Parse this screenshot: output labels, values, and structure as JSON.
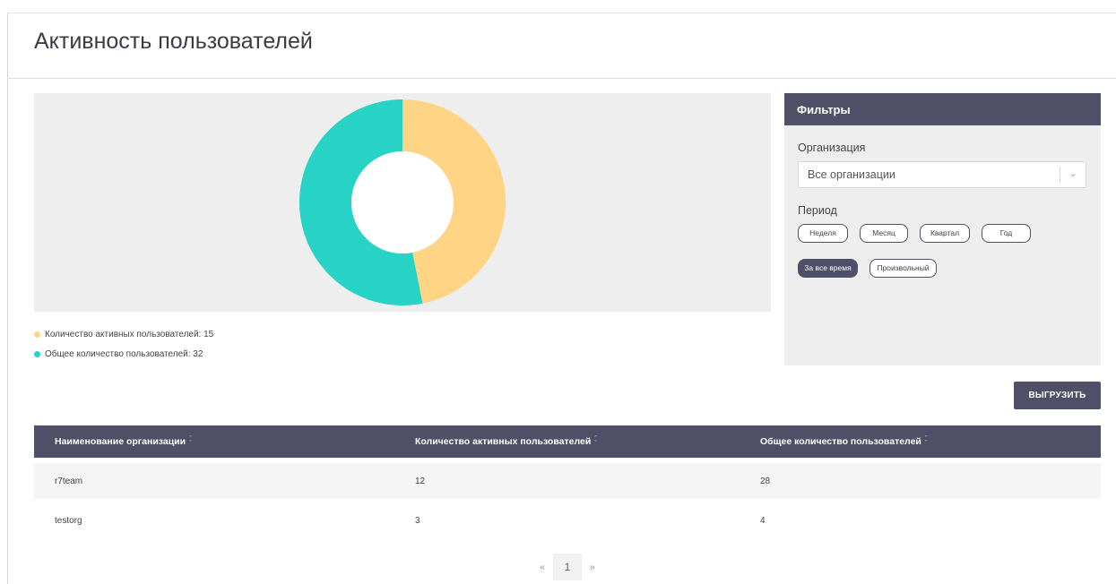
{
  "page": {
    "title": "Активность пользователей"
  },
  "chart_data": {
    "type": "pie",
    "donut": true,
    "slices": [
      {
        "label": "Количество активных пользователей",
        "value": 15,
        "color": "#ffd485"
      },
      {
        "label": "Общее количество пользователей",
        "value": 32,
        "color": "#26d3c4"
      }
    ]
  },
  "legend": {
    "items": [
      {
        "text": "Количество активных пользователей: 15",
        "color": "#ffd485"
      },
      {
        "text": "Общее количество пользователей: 32",
        "color": "#26d3c4"
      }
    ]
  },
  "filters": {
    "title": "Фильтры",
    "organization_label": "Организация",
    "organization_value": "Все организации",
    "period_label": "Период",
    "period_options": [
      "Неделя",
      "Месяц",
      "Квартал",
      "Год",
      "За все время",
      "Произвольный"
    ],
    "period_selected": "За все время"
  },
  "export_label": "ВЫГРУЗИТЬ",
  "table": {
    "headers": [
      "Наименование организации",
      "Количество активных пользователей",
      "Общее количество пользователей"
    ],
    "rows": [
      [
        "r7team",
        "12",
        "28"
      ],
      [
        "testorg",
        "3",
        "4"
      ]
    ]
  },
  "pagination": {
    "prev": "«",
    "current": "1",
    "next": "»"
  },
  "colors": {
    "accent": "#4f4f67",
    "panel": "#eeeeee"
  }
}
